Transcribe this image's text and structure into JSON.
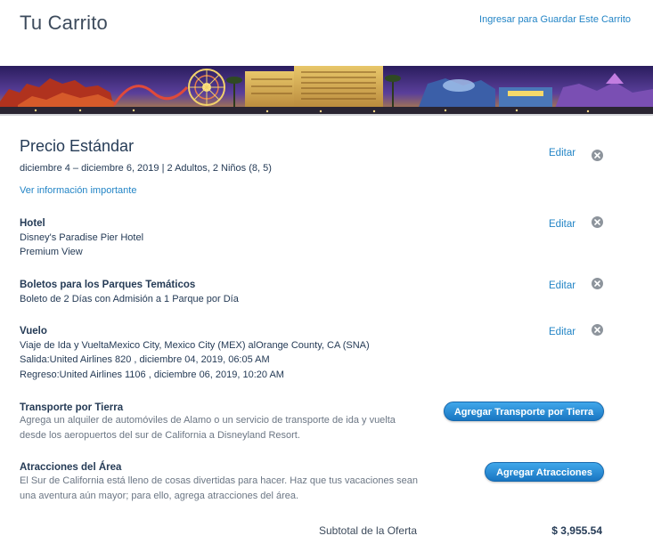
{
  "header": {
    "title": "Tu Carrito",
    "signin_link": "Ingresar para Guardar Este Carrito"
  },
  "banner": {
    "icon": "disneyland-resort-night-panorama"
  },
  "package": {
    "title": "Precio Estándar",
    "dates": "diciembre 4 – diciembre 6, 2019 | 2 Adultos, 2 Niños (8, 5)",
    "info_link": "Ver información importante",
    "edit_label": "Editar"
  },
  "hotel": {
    "title": "Hotel",
    "name": "Disney's Paradise Pier Hotel",
    "room": "Premium View",
    "edit_label": "Editar"
  },
  "tickets": {
    "title": "Boletos para los Parques Temáticos",
    "description": "Boleto de 2 Días con Admisión a 1 Parque por Día",
    "edit_label": "Editar"
  },
  "flight": {
    "title": "Vuelo",
    "route": "Viaje de Ida y VueltaMexico City, Mexico City (MEX) alOrange County, CA (SNA)",
    "departure": "Salida:United Airlines 820 , diciembre 04, 2019, 06:05 AM",
    "return": "Regreso:United Airlines 1106 , diciembre 06, 2019, 10:20 AM",
    "edit_label": "Editar"
  },
  "ground": {
    "title": "Transporte por Tierra",
    "description": "Agrega un alquiler de automóviles de Alamo o un servicio de transporte de ida y vuelta desde los aeropuertos del sur de California a Disneyland Resort.",
    "button": "Agregar Transporte por Tierra"
  },
  "attractions": {
    "title": "Atracciones del Área",
    "description": "El Sur de California está lleno de cosas divertidas para hacer. Haz que tus vacaciones sean una aventura aún mayor; para ello, agrega atracciones del área.",
    "button": "Agregar Atracciones"
  },
  "summary": {
    "label": "Subtotal de la Oferta",
    "value": "$ 3,955.54"
  },
  "colors": {
    "link": "#2385c6",
    "text": "#253b56",
    "button": "#1976c2",
    "remove": "#8d949c"
  }
}
